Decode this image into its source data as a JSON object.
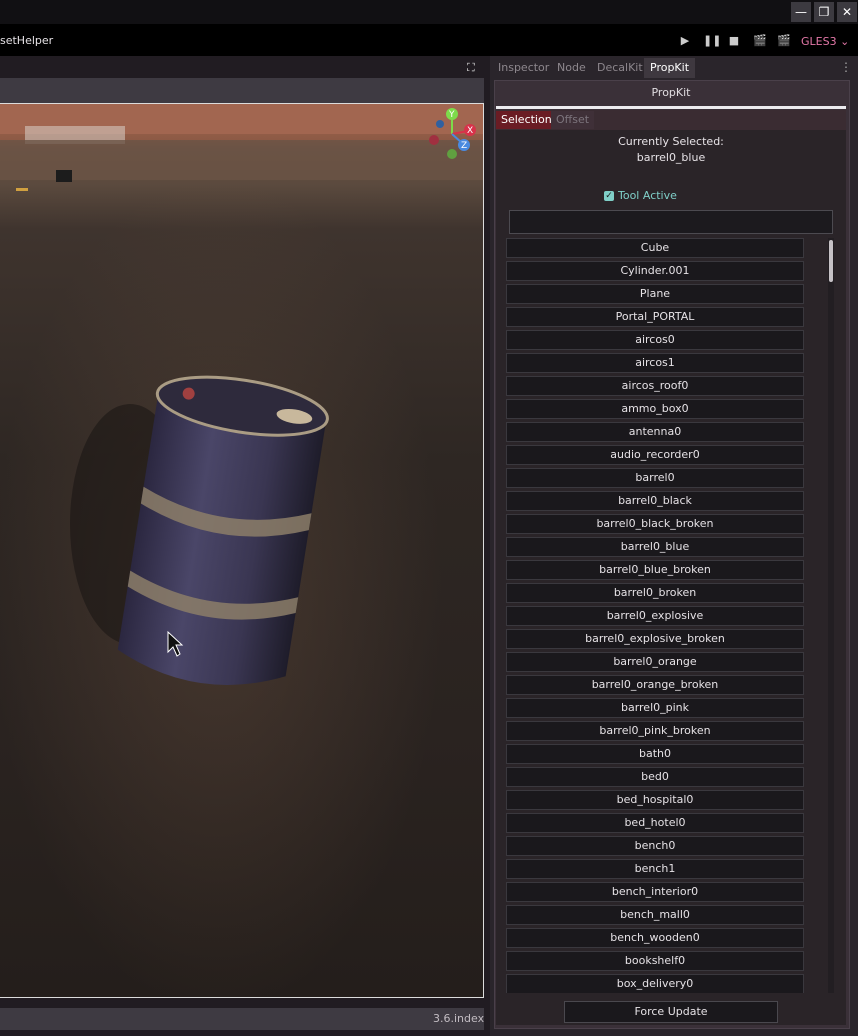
{
  "scene": {
    "tab_label": "setHelper"
  },
  "toolbar": {
    "renderer": "GLES3",
    "icons": [
      "play-icon",
      "pause-icon",
      "stop-icon",
      "play-scene-icon",
      "play-custom-icon"
    ]
  },
  "window": {
    "buttons": [
      "minimize",
      "restore",
      "close"
    ]
  },
  "viewport": {
    "status_label": "3.6.index",
    "gizmo_axes": [
      "Y",
      "X",
      "Z"
    ]
  },
  "dock": {
    "tabs": [
      "Inspector",
      "Node",
      "DecalKit",
      "PropKit"
    ],
    "active_tab": "PropKit"
  },
  "propkit": {
    "title": "PropKit",
    "subtabs": [
      "Selection",
      "Offset"
    ],
    "current_label": "Currently Selected:",
    "current_value": "barrel0_blue",
    "tool_active_label": "Tool Active",
    "tool_active": true,
    "search_value": "",
    "items": [
      "Cube",
      "Cylinder.001",
      "Plane",
      "Portal_PORTAL",
      "aircos0",
      "aircos1",
      "aircos_roof0",
      "ammo_box0",
      "antenna0",
      "audio_recorder0",
      "barrel0",
      "barrel0_black",
      "barrel0_black_broken",
      "barrel0_blue",
      "barrel0_blue_broken",
      "barrel0_broken",
      "barrel0_explosive",
      "barrel0_explosive_broken",
      "barrel0_orange",
      "barrel0_orange_broken",
      "barrel0_pink",
      "barrel0_pink_broken",
      "bath0",
      "bed0",
      "bed_hospital0",
      "bed_hotel0",
      "bench0",
      "bench1",
      "bench_interior0",
      "bench_mall0",
      "bench_wooden0",
      "bookshelf0",
      "box_delivery0"
    ],
    "force_update_label": "Force Update"
  },
  "colors": {
    "accent": "#e478a8",
    "tool_active": "#7fcfc8",
    "selection_tab": "#6a1c24"
  }
}
